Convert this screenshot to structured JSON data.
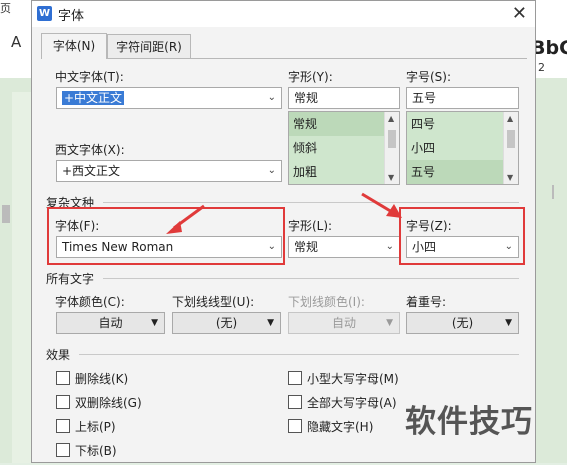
{
  "background": {
    "left_top_text": "页",
    "left_mid_text": "A",
    "right_big_text": "BbC(",
    "right_small_text": "2"
  },
  "dialog": {
    "title": "字体",
    "tabs": [
      "字体(N)",
      "字符间距(R)"
    ],
    "chinese_font": {
      "label": "中文字体(T):",
      "value": "+中文正文"
    },
    "western_font": {
      "label": "西文字体(X):",
      "value": "+西文正文"
    },
    "style": {
      "label": "字形(Y):",
      "value": "常规",
      "options": [
        "常规",
        "倾斜",
        "加粗"
      ]
    },
    "size": {
      "label": "字号(S):",
      "value": "五号",
      "options": [
        "四号",
        "小四",
        "五号"
      ]
    },
    "complex_section": "复杂文种",
    "complex_font": {
      "label": "字体(F):",
      "value": "Times New Roman"
    },
    "complex_style": {
      "label": "字形(L):",
      "value": "常规"
    },
    "complex_size": {
      "label": "字号(Z):",
      "value": "小四"
    },
    "all_text_section": "所有文字",
    "font_color": {
      "label": "字体颜色(C):",
      "value": "自动"
    },
    "underline_type": {
      "label": "下划线线型(U):",
      "value": "(无)"
    },
    "underline_color": {
      "label": "下划线颜色(I):",
      "value": "自动"
    },
    "emphasis": {
      "label": "着重号:",
      "value": "(无)"
    },
    "effects_section": "效果",
    "effects_left": [
      "删除线(K)",
      "双删除线(G)",
      "上标(P)",
      "下标(B)"
    ],
    "effects_right": [
      "小型大写字母(M)",
      "全部大写字母(A)",
      "隐藏文字(H)"
    ]
  },
  "watermark": "软件技巧",
  "colors": {
    "highlight": "#e03a3a",
    "list_bg": "#cfe6cd",
    "selection": "#3a7bd5"
  }
}
